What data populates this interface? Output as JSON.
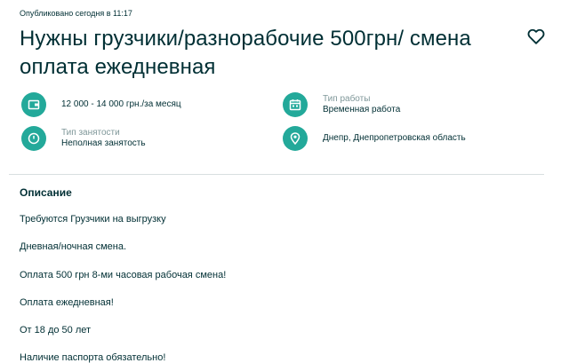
{
  "published": "Опубликовано сегодня в 11:17",
  "title": "Нужны грузчики/разнорабочие 500грн/ смена оплата ежедневная",
  "attributes": [
    {
      "icon": "wallet-icon",
      "label": "",
      "value": "12 000 - 14 000 грн./за месяц"
    },
    {
      "icon": "clock-icon",
      "label": "Тип занятости",
      "value": "Неполная занятость"
    },
    {
      "icon": "calendar-icon",
      "label": "Тип работы",
      "value": "Временная работа"
    },
    {
      "icon": "location-pin-icon",
      "label": "",
      "value": "Днепр, Днепропетровская область"
    }
  ],
  "description": {
    "title": "Описание",
    "lines": [
      "Требуются Грузчики на выгрузку",
      "Дневная/ночная смена.",
      "Оплата 500 грн 8-ми часовая рабочая смена!",
      "Оплата ежедневная!",
      "От 18 до 50 лет",
      "Наличие паспорта обязательно!"
    ]
  },
  "colors": {
    "accent": "#23a99a",
    "text": "#002f34",
    "muted": "#7f9799"
  }
}
